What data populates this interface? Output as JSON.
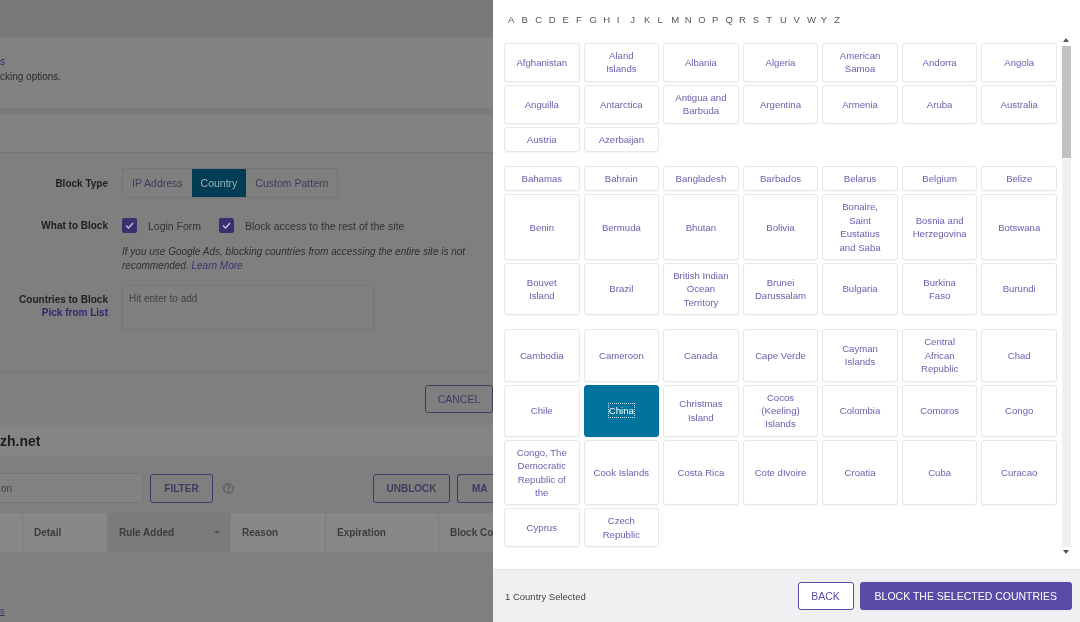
{
  "background_page": {
    "header_link": "s",
    "description": "cking options.",
    "block_type": {
      "label": "Block Type",
      "options": [
        {
          "label": "IP Address",
          "selected": false
        },
        {
          "label": "Country",
          "selected": true
        },
        {
          "label": "Custom Pattern",
          "selected": false
        }
      ]
    },
    "what_to_block": {
      "label": "What to Block",
      "options": [
        {
          "label": "Login Form",
          "checked": true
        },
        {
          "label": "Block access to the rest of the site",
          "checked": true
        }
      ]
    },
    "note": "If you use Google Ads, blocking countries from accessing the entire site is not recommended.",
    "note_link": "Learn More",
    "countries_field": {
      "label": "Countries to Block",
      "link": "Pick from List",
      "placeholder": "Hit enter to add"
    },
    "cancel_button": "CANCEL",
    "site_title": "zh.net",
    "filter_field": {
      "placeholder": "on"
    },
    "filter_button": "FILTER",
    "unblock_button": "UNBLOCK",
    "more_button": "MA",
    "table": {
      "columns": [
        {
          "label": "Detail",
          "sorted": false
        },
        {
          "label": "Rule Added",
          "sorted": true
        },
        {
          "label": "Reason",
          "sorted": false
        },
        {
          "label": "Expiration",
          "sorted": false
        },
        {
          "label": "Block Co",
          "sorted": false
        }
      ]
    },
    "footer_link": "s"
  },
  "country_picker": {
    "letters": [
      "A",
      "B",
      "C",
      "D",
      "E",
      "F",
      "G",
      "H",
      "I",
      "J",
      "K",
      "L",
      "M",
      "N",
      "O",
      "P",
      "Q",
      "R",
      "S",
      "T",
      "U",
      "V",
      "W",
      "Y",
      "Z"
    ],
    "groups": [
      {
        "countries": [
          {
            "name": "Afghanistan",
            "selected": false
          },
          {
            "name": "Aland Islands",
            "selected": false
          },
          {
            "name": "Albania",
            "selected": false
          },
          {
            "name": "Algeria",
            "selected": false
          },
          {
            "name": "American Samoa",
            "selected": false
          },
          {
            "name": "Andorra",
            "selected": false
          },
          {
            "name": "Angola",
            "selected": false
          },
          {
            "name": "Anguilla",
            "selected": false
          },
          {
            "name": "Antarctica",
            "selected": false
          },
          {
            "name": "Antigua and Barbuda",
            "selected": false
          },
          {
            "name": "Argentina",
            "selected": false
          },
          {
            "name": "Armenia",
            "selected": false
          },
          {
            "name": "Aruba",
            "selected": false
          },
          {
            "name": "Australia",
            "selected": false
          },
          {
            "name": "Austria",
            "selected": false
          },
          {
            "name": "Azerbaijan",
            "selected": false
          }
        ]
      },
      {
        "countries": [
          {
            "name": "Bahamas",
            "selected": false
          },
          {
            "name": "Bahrain",
            "selected": false
          },
          {
            "name": "Bangladesh",
            "selected": false
          },
          {
            "name": "Barbados",
            "selected": false
          },
          {
            "name": "Belarus",
            "selected": false
          },
          {
            "name": "Belgium",
            "selected": false
          },
          {
            "name": "Belize",
            "selected": false
          },
          {
            "name": "Benin",
            "selected": false
          },
          {
            "name": "Bermuda",
            "selected": false
          },
          {
            "name": "Bhutan",
            "selected": false
          },
          {
            "name": "Bolivia",
            "selected": false
          },
          {
            "name": "Bonaire, Saint Eustatius and Saba",
            "selected": false
          },
          {
            "name": "Bosnia and Herzegovina",
            "selected": false
          },
          {
            "name": "Botswana",
            "selected": false
          },
          {
            "name": "Bouvet Island",
            "selected": false
          },
          {
            "name": "Brazil",
            "selected": false
          },
          {
            "name": "British Indian Ocean Territory",
            "selected": false
          },
          {
            "name": "Brunei Darussalam",
            "selected": false
          },
          {
            "name": "Bulgaria",
            "selected": false
          },
          {
            "name": "Burkina Faso",
            "selected": false
          },
          {
            "name": "Burundi",
            "selected": false
          }
        ]
      },
      {
        "countries": [
          {
            "name": "Cambodia",
            "selected": false
          },
          {
            "name": "Cameroon",
            "selected": false
          },
          {
            "name": "Canada",
            "selected": false
          },
          {
            "name": "Cape Verde",
            "selected": false
          },
          {
            "name": "Cayman Islands",
            "selected": false
          },
          {
            "name": "Central African Republic",
            "selected": false
          },
          {
            "name": "Chad",
            "selected": false
          },
          {
            "name": "Chile",
            "selected": false
          },
          {
            "name": "China",
            "selected": true
          },
          {
            "name": "Christmas Island",
            "selected": false
          },
          {
            "name": "Cocos (Keeling) Islands",
            "selected": false
          },
          {
            "name": "Colombia",
            "selected": false
          },
          {
            "name": "Comoros",
            "selected": false
          },
          {
            "name": "Congo",
            "selected": false
          },
          {
            "name": "Congo, The Democratic Republic of the",
            "selected": false
          },
          {
            "name": "Cook Islands",
            "selected": false
          },
          {
            "name": "Costa Rica",
            "selected": false
          },
          {
            "name": "Cote dIvoire",
            "selected": false
          },
          {
            "name": "Croatia",
            "selected": false
          },
          {
            "name": "Cuba",
            "selected": false
          },
          {
            "name": "Curacao",
            "selected": false
          },
          {
            "name": "Cyprus",
            "selected": false
          },
          {
            "name": "Czech Republic",
            "selected": false
          }
        ]
      }
    ],
    "selection_count": "1 Country Selected",
    "back_button": "BACK",
    "block_button": "BLOCK THE SELECTED COUNTRIES"
  }
}
